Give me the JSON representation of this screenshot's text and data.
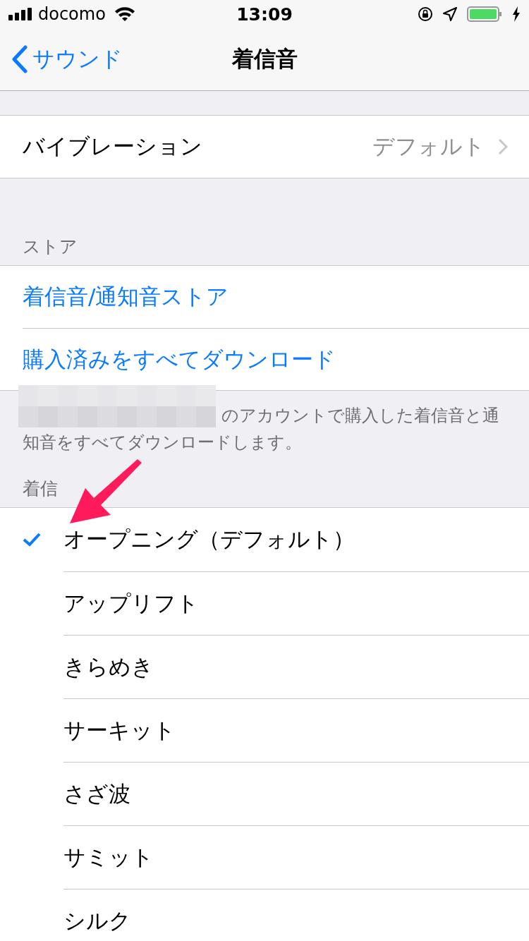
{
  "status_bar": {
    "carrier": "docomo",
    "time": "13:09"
  },
  "nav": {
    "back": "サウンド",
    "title": "着信音"
  },
  "vibration": {
    "label": "バイブレーション",
    "value": "デフォルト"
  },
  "store": {
    "header": "ストア",
    "links": [
      "着信音/通知音ストア",
      "購入済みをすべてダウンロード"
    ],
    "footer": [
      "のアカウントで購入した着信音と通",
      "知音をすべてダウンロードします。"
    ]
  },
  "ringtones": {
    "header": "着信",
    "items": [
      {
        "name": "オープニング（デフォルト）",
        "selected": true
      },
      {
        "name": "アップリフト",
        "selected": false
      },
      {
        "name": "きらめき",
        "selected": false
      },
      {
        "name": "サーキット",
        "selected": false
      },
      {
        "name": "さざ波",
        "selected": false
      },
      {
        "name": "サミット",
        "selected": false
      },
      {
        "name": "シルク",
        "selected": false
      }
    ]
  }
}
